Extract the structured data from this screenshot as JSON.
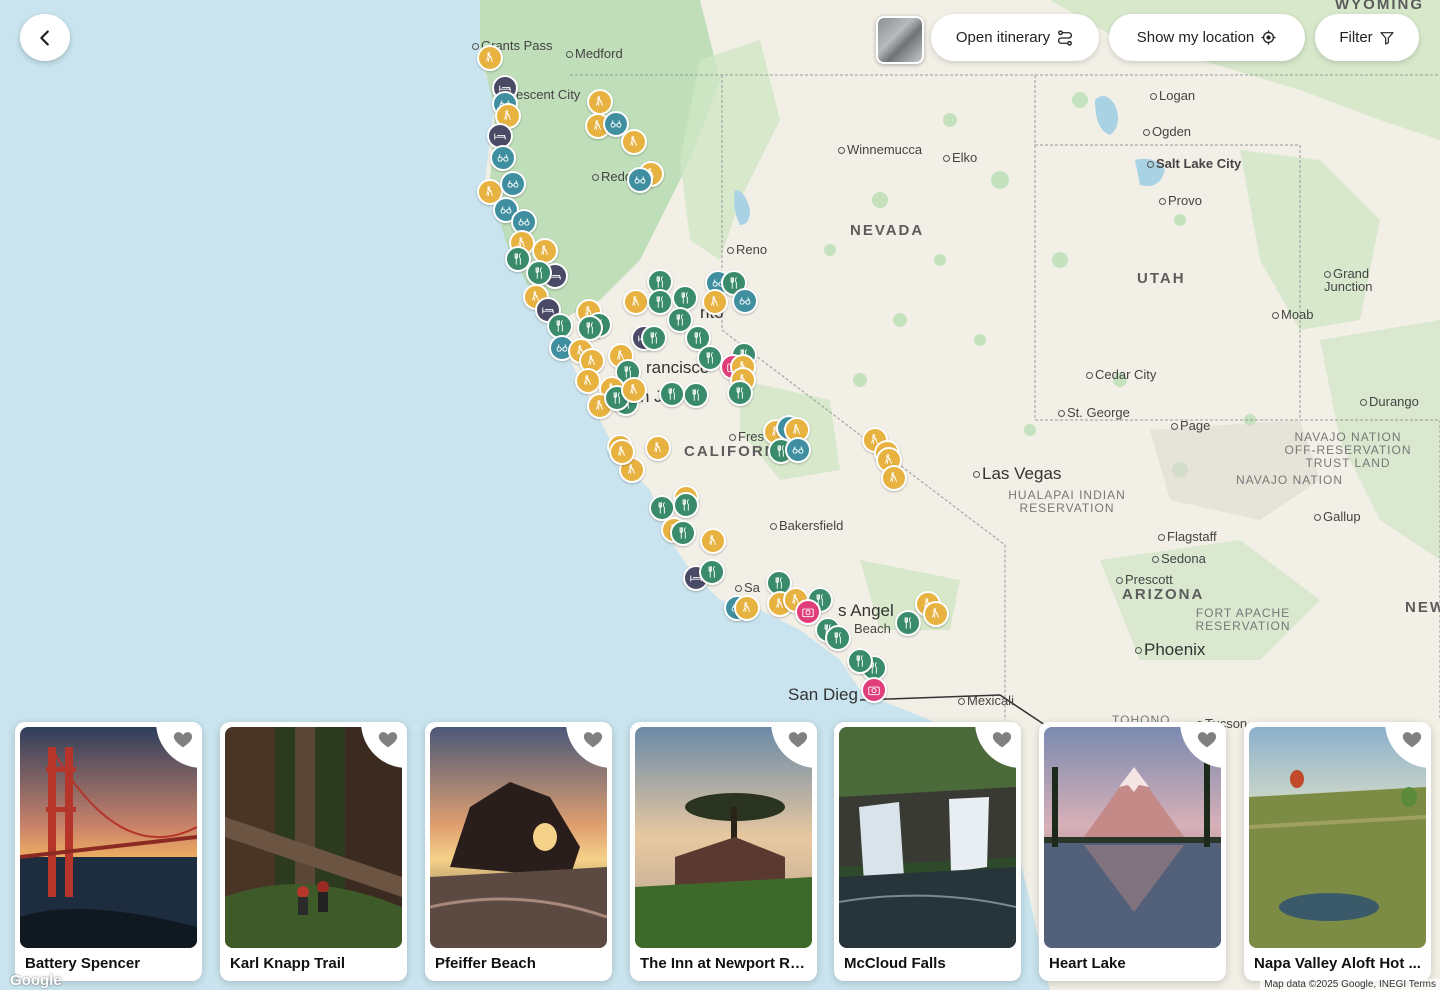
{
  "toolbar": {
    "back_icon": "chevron-left-icon",
    "open_itinerary_label": "Open itinerary",
    "show_location_label": "Show my location",
    "filter_label": "Filter"
  },
  "map": {
    "labels": [
      {
        "text": "Grants Pass",
        "cls": "dot-right"
      },
      {
        "text": "Medford",
        "cls": "dot"
      },
      {
        "text": "escent City",
        "cls": ""
      },
      {
        "text": "Redd",
        "cls": "dot"
      },
      {
        "text": "Winnemucca",
        "cls": "dot"
      },
      {
        "text": "Elko",
        "cls": "dot"
      },
      {
        "text": "Logan",
        "cls": "dot"
      },
      {
        "text": "Ogden",
        "cls": "dot"
      },
      {
        "text": "Salt Lake City",
        "cls": "dot"
      },
      {
        "text": "Provo",
        "cls": "dot"
      },
      {
        "text": "NEVADA",
        "cls": "state"
      },
      {
        "text": "UTAH",
        "cls": "state"
      },
      {
        "text": "Reno",
        "cls": "dot"
      },
      {
        "text": "Grand Junction",
        "cls": ""
      },
      {
        "text": "Moab",
        "cls": "dot"
      },
      {
        "text": "Cedar City",
        "cls": "dot"
      },
      {
        "text": "St. George",
        "cls": "dot"
      },
      {
        "text": "Page",
        "cls": "dot"
      },
      {
        "text": "Durango",
        "cls": "dot"
      },
      {
        "text": "NAVAJO NATION OFF-RESERVATION TRUST LAND",
        "cls": "res"
      },
      {
        "text": "NAVAJO NATION",
        "cls": "res"
      },
      {
        "text": "Las Vegas",
        "cls": "big"
      },
      {
        "text": "HUALAPAI INDIAN RESERVATION",
        "cls": "res"
      },
      {
        "text": "Gallup",
        "cls": "dot"
      },
      {
        "text": "Flagstaff",
        "cls": "dot"
      },
      {
        "text": "Sedona",
        "cls": "dot"
      },
      {
        "text": "Prescott",
        "cls": "dot"
      },
      {
        "text": "ARIZONA",
        "cls": "state"
      },
      {
        "text": "FORT APACHE RESERVATION",
        "cls": "res"
      },
      {
        "text": "Phoenix",
        "cls": "big"
      },
      {
        "text": "NEW",
        "cls": "state"
      },
      {
        "text": "Bakersfield",
        "cls": "dot"
      },
      {
        "text": "Fres",
        "cls": "dot"
      },
      {
        "text": "CALIFORN",
        "cls": "state"
      },
      {
        "text": "rancisco",
        "cls": "big"
      },
      {
        "text": "n Jo",
        "cls": "big"
      },
      {
        "text": "nto",
        "cls": "big"
      },
      {
        "text": "San Dieg",
        "cls": "big"
      },
      {
        "text": "Mexicali",
        "cls": "dot"
      },
      {
        "text": "s Angel",
        "cls": "big"
      },
      {
        "text": "Beach",
        "cls": ""
      },
      {
        "text": "Sa",
        "cls": "dot"
      },
      {
        "text": "WYOMING",
        "cls": "state"
      },
      {
        "text": "Tucson",
        "cls": "dot"
      },
      {
        "text": "TOHONO",
        "cls": "res"
      }
    ],
    "google": "Google",
    "copyright": "Map data ©2025 Google, INEGI   Terms"
  },
  "cards": [
    {
      "title": "Battery Spencer",
      "photo": "golden-gate"
    },
    {
      "title": "Karl Knapp Trail",
      "photo": "redwoods"
    },
    {
      "title": "Pfeiffer Beach",
      "photo": "beach-sunset"
    },
    {
      "title": "The Inn at Newport Ra...",
      "photo": "inn"
    },
    {
      "title": "McCloud Falls",
      "photo": "waterfall"
    },
    {
      "title": "Heart Lake",
      "photo": "mountain-lake"
    },
    {
      "title": "Napa Valley Aloft Hot ...",
      "photo": "balloons"
    }
  ],
  "colors": {
    "hike": "#e8b240",
    "food": "#3a8b6c",
    "view": "#3f8fa0",
    "stay": "#4b4a66",
    "photo": "#e03e7a",
    "water": "#c9e4ee",
    "land": "#f2efe6",
    "forest": "#b9dcb4"
  }
}
